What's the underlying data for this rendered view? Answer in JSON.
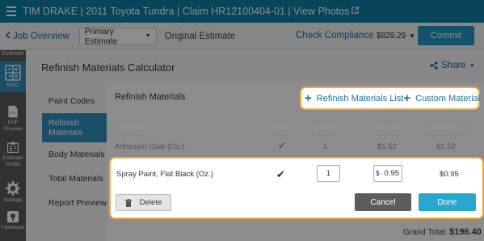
{
  "header": {
    "title": "TIM DRAKE | 2011 Toyota Tundra | Claim HR12100404-01 | View Photos",
    "external_icon": "external-link-icon"
  },
  "subbar": {
    "back_label": "Job Overview",
    "estimate_select": "Primary Estimate",
    "estimate_name": "Original Estimate",
    "check_compliance": "Check Compliance",
    "total": "$829.29",
    "commit_label": "Commit"
  },
  "leftbar": {
    "estimate_label": "Estimate",
    "items": [
      {
        "label": "RMC",
        "icon": "calculator-icon"
      },
      {
        "label": "PDF Preview",
        "icon": "pdf-icon"
      },
      {
        "label": "Estimate Profile",
        "icon": "profile-icon"
      },
      {
        "label": "Settings",
        "icon": "gear-icon"
      },
      {
        "label": "Feedback",
        "icon": "feedback-icon"
      }
    ]
  },
  "main": {
    "title": "Refinish Materials Calculator",
    "share_label": "Share",
    "nav": [
      "Paint Codes",
      "Refinish Materials",
      "Body Materials",
      "Total Materials",
      "Report Preview"
    ]
  },
  "panel": {
    "title": "Refinish Materials",
    "actions": {
      "list_label": "Refinish Materials List",
      "custom_label": "Custom Material"
    },
    "columns": [
      "Description",
      "Paint",
      "Quantity",
      "Unit Cost",
      "Extended Cost"
    ],
    "rows": [
      {
        "description": "Adhesion Coat (Oz.)",
        "paint": "✔",
        "quantity": "1",
        "unit_cost": "$1.52",
        "extended_cost": "$1.52"
      }
    ],
    "editing": {
      "description": "Spray Paint, Flat Black (Oz.)",
      "paint": "✔",
      "quantity": "1",
      "currency": "$",
      "unit_cost": "0.95",
      "extended_cost": "$0.95",
      "delete_label": "Delete",
      "cancel_label": "Cancel",
      "done_label": "Done"
    }
  },
  "footer": {
    "grand_total_label": "Grand Total:",
    "grand_total_value": "$196.40"
  },
  "colors": {
    "brand": "#0e7fa6",
    "accent": "#2296c3",
    "highlight": "#f3a535"
  }
}
